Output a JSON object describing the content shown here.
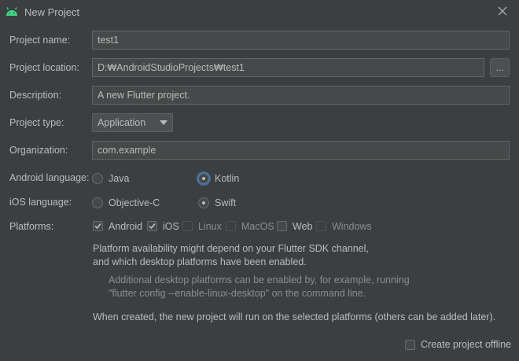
{
  "window": {
    "title": "New Project"
  },
  "labels": {
    "name": "Project name:",
    "location": "Project location:",
    "description": "Description:",
    "type": "Project type:",
    "organization": "Organization:",
    "android_language": "Android language:",
    "ios_language": "iOS language:",
    "platforms": "Platforms:"
  },
  "fields": {
    "name": "test1",
    "location": "D:₩AndroidStudioProjects₩test1",
    "browse": "...",
    "description": "A new Flutter project.",
    "type": "Application",
    "organization": "com.example"
  },
  "android_language": {
    "options": [
      "Java",
      "Kotlin"
    ],
    "selected": "Kotlin"
  },
  "ios_language": {
    "options": [
      "Objective-C",
      "Swift"
    ],
    "selected": "Swift"
  },
  "platforms": [
    {
      "label": "Android",
      "checked": true,
      "enabled": true
    },
    {
      "label": "iOS",
      "checked": true,
      "enabled": true
    },
    {
      "label": "Linux",
      "checked": false,
      "enabled": false
    },
    {
      "label": "MacOS",
      "checked": false,
      "enabled": false
    },
    {
      "label": "Web",
      "checked": false,
      "enabled": true
    },
    {
      "label": "Windows",
      "checked": false,
      "enabled": false
    }
  ],
  "notes": {
    "availability_1": "Platform availability might depend on your Flutter SDK channel,",
    "availability_2": "and which desktop platforms have been enabled.",
    "desktop_1": "Additional desktop platforms can be enabled by, for example, running",
    "desktop_2": "\"flutter config --enable-linux-desktop\" on the command line.",
    "created": "When created, the new project will run on the selected platforms (others can be added later)."
  },
  "offline": {
    "label": "Create project offline",
    "checked": false
  },
  "colors": {
    "background": "#3c3f41",
    "field": "#45494a",
    "text": "#bbbbbb",
    "android_green": "#3ddc84",
    "focus": "#466d94"
  }
}
